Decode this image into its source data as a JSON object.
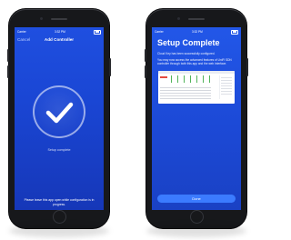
{
  "left_phone": {
    "status": {
      "carrier": "Carrier",
      "time": "3:32 PM",
      "battery_icon": "battery-icon"
    },
    "nav": {
      "cancel": "Cancel",
      "title": "Add Controller"
    },
    "check_icon": "checkmark-circle-icon",
    "caption": "Setup complete",
    "bottom_note": "Please leave this app open while configuration is in progress."
  },
  "right_phone": {
    "status": {
      "carrier": "Carrier",
      "time": "3:32 PM",
      "battery_icon": "battery-icon"
    },
    "title": "Setup Complete",
    "line1": "Cloud Key has been successfully configured.",
    "line2": "You may now access the advanced features of UniFi SDN controller through both this app and the web interface.",
    "done_label": "Done"
  },
  "colors": {
    "screen_blue": "#1f4fe0",
    "done_button": "#3b7bff",
    "phone_body": "#17181b"
  }
}
